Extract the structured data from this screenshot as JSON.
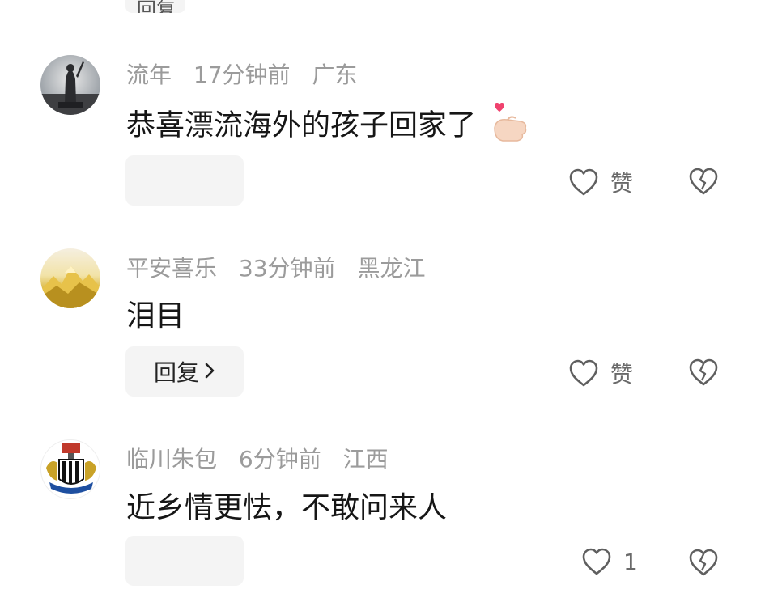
{
  "top_reply": {
    "label": "回复"
  },
  "comments": [
    {
      "username": "流年",
      "time": "17分钟前",
      "location": "广东",
      "text": "恭喜漂流海外的孩子回家了",
      "emoji": "🫰",
      "reply_label": "",
      "like_label": "赞"
    },
    {
      "username": "平安喜乐",
      "time": "33分钟前",
      "location": "黑龙江",
      "text": "泪目",
      "reply_label": "回复",
      "like_label": "赞"
    },
    {
      "username": "临川朱包",
      "time": "6分钟前",
      "location": "江西",
      "text": "近乡情更怯，不敢问来人",
      "reply_label": "",
      "like_label": "1"
    }
  ],
  "colors": {
    "meta": "#9b9b9b",
    "text": "#161616",
    "icon": "#5f5f5f",
    "reply_bg": "#f4f4f4"
  }
}
